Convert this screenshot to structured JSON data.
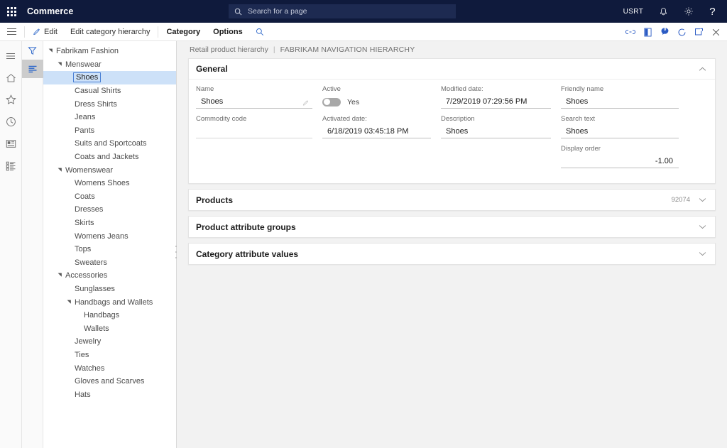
{
  "header": {
    "app_title": "Commerce",
    "waffle_icon": "app-launcher-icon",
    "search": {
      "placeholder": "Search for a page",
      "value": "",
      "icon": "search-icon"
    },
    "user_initials": "USRT",
    "notifications_icon": "bell-icon",
    "settings_icon": "gear-icon",
    "help_icon": "question-mark-icon",
    "help_label": "?"
  },
  "commandbar": {
    "hamburger_icon": "hamburger-icon",
    "buttons": [
      {
        "label": "Edit",
        "icon": "pencil-icon",
        "strong": false
      },
      {
        "label": "Edit category hierarchy",
        "icon": "",
        "strong": false
      },
      {
        "label": "Category",
        "icon": "",
        "strong": true
      },
      {
        "label": "Options",
        "icon": "",
        "strong": true
      }
    ],
    "search_icon": "search-icon",
    "right_icons": [
      {
        "name": "attach-link-icon"
      },
      {
        "name": "office-app-icon"
      },
      {
        "name": "comments-icon",
        "badge": "0"
      },
      {
        "name": "refresh-icon"
      },
      {
        "name": "popout-window-icon"
      },
      {
        "name": "close-icon"
      }
    ]
  },
  "rail": {
    "items": [
      {
        "name": "menu-icon"
      },
      {
        "name": "home-icon"
      },
      {
        "name": "favorites-star-icon"
      },
      {
        "name": "recent-clock-icon"
      },
      {
        "name": "workspaces-icon"
      },
      {
        "name": "modules-list-icon"
      }
    ]
  },
  "rail2": {
    "items": [
      {
        "name": "filter-icon",
        "selected": false
      },
      {
        "name": "hierarchy-list-icon",
        "selected": true
      }
    ]
  },
  "tree": {
    "nodes": [
      {
        "label": "Fabrikam Fashion",
        "depth": 0,
        "expandable": true,
        "selected": false
      },
      {
        "label": "Menswear",
        "depth": 1,
        "expandable": true,
        "selected": false
      },
      {
        "label": "Shoes",
        "depth": 2,
        "expandable": false,
        "selected": true
      },
      {
        "label": "Casual Shirts",
        "depth": 2,
        "expandable": false,
        "selected": false
      },
      {
        "label": "Dress Shirts",
        "depth": 2,
        "expandable": false,
        "selected": false
      },
      {
        "label": "Jeans",
        "depth": 2,
        "expandable": false,
        "selected": false
      },
      {
        "label": "Pants",
        "depth": 2,
        "expandable": false,
        "selected": false
      },
      {
        "label": "Suits and Sportcoats",
        "depth": 2,
        "expandable": false,
        "selected": false
      },
      {
        "label": "Coats and Jackets",
        "depth": 2,
        "expandable": false,
        "selected": false
      },
      {
        "label": "Womenswear",
        "depth": 1,
        "expandable": true,
        "selected": false
      },
      {
        "label": "Womens Shoes",
        "depth": 2,
        "expandable": false,
        "selected": false
      },
      {
        "label": "Coats",
        "depth": 2,
        "expandable": false,
        "selected": false
      },
      {
        "label": "Dresses",
        "depth": 2,
        "expandable": false,
        "selected": false
      },
      {
        "label": "Skirts",
        "depth": 2,
        "expandable": false,
        "selected": false
      },
      {
        "label": "Womens Jeans",
        "depth": 2,
        "expandable": false,
        "selected": false
      },
      {
        "label": "Tops",
        "depth": 2,
        "expandable": false,
        "selected": false
      },
      {
        "label": "Sweaters",
        "depth": 2,
        "expandable": false,
        "selected": false
      },
      {
        "label": "Accessories",
        "depth": 1,
        "expandable": true,
        "selected": false
      },
      {
        "label": "Sunglasses",
        "depth": 2,
        "expandable": false,
        "selected": false
      },
      {
        "label": "Handbags and Wallets",
        "depth": 2,
        "expandable": true,
        "selected": false
      },
      {
        "label": "Handbags",
        "depth": 3,
        "expandable": false,
        "selected": false
      },
      {
        "label": "Wallets",
        "depth": 3,
        "expandable": false,
        "selected": false
      },
      {
        "label": "Jewelry",
        "depth": 2,
        "expandable": false,
        "selected": false
      },
      {
        "label": "Ties",
        "depth": 2,
        "expandable": false,
        "selected": false
      },
      {
        "label": "Watches",
        "depth": 2,
        "expandable": false,
        "selected": false
      },
      {
        "label": "Gloves and Scarves",
        "depth": 2,
        "expandable": false,
        "selected": false
      },
      {
        "label": "Hats",
        "depth": 2,
        "expandable": false,
        "selected": false
      }
    ]
  },
  "breadcrumb": {
    "parent": "Retail product hierarchy",
    "separator": "|",
    "current": "FABRIKAM NAVIGATION HIERARCHY"
  },
  "general": {
    "title": "General",
    "collapse_icon": "chevron-up-icon",
    "fields": {
      "name": {
        "label": "Name",
        "value": "Shoes",
        "edit_icon": "pencil-icon"
      },
      "commodity_code": {
        "label": "Commodity code",
        "value": ""
      },
      "active": {
        "label": "Active",
        "value": "Yes",
        "on": false
      },
      "activated_date": {
        "label": "Activated date:",
        "value": "6/18/2019 03:45:18 PM"
      },
      "modified_date": {
        "label": "Modified date:",
        "value": "7/29/2019 07:29:56 PM"
      },
      "description": {
        "label": "Description",
        "value": "Shoes"
      },
      "friendly_name": {
        "label": "Friendly name",
        "value": "Shoes"
      },
      "search_text": {
        "label": "Search text",
        "value": "Shoes"
      },
      "display_order": {
        "label": "Display order",
        "value": "-1.00"
      }
    }
  },
  "sections": [
    {
      "title": "Products",
      "count": "92074",
      "expand_icon": "chevron-down-icon"
    },
    {
      "title": "Product attribute groups",
      "count": "",
      "expand_icon": "chevron-down-icon"
    },
    {
      "title": "Category attribute values",
      "count": "",
      "expand_icon": "chevron-down-icon"
    }
  ],
  "colors": {
    "header_navy": "#0f1a3c",
    "accent_blue": "#2266dd",
    "selection_blue": "#cde1f8",
    "canvas_gray": "#f2f2f2"
  }
}
